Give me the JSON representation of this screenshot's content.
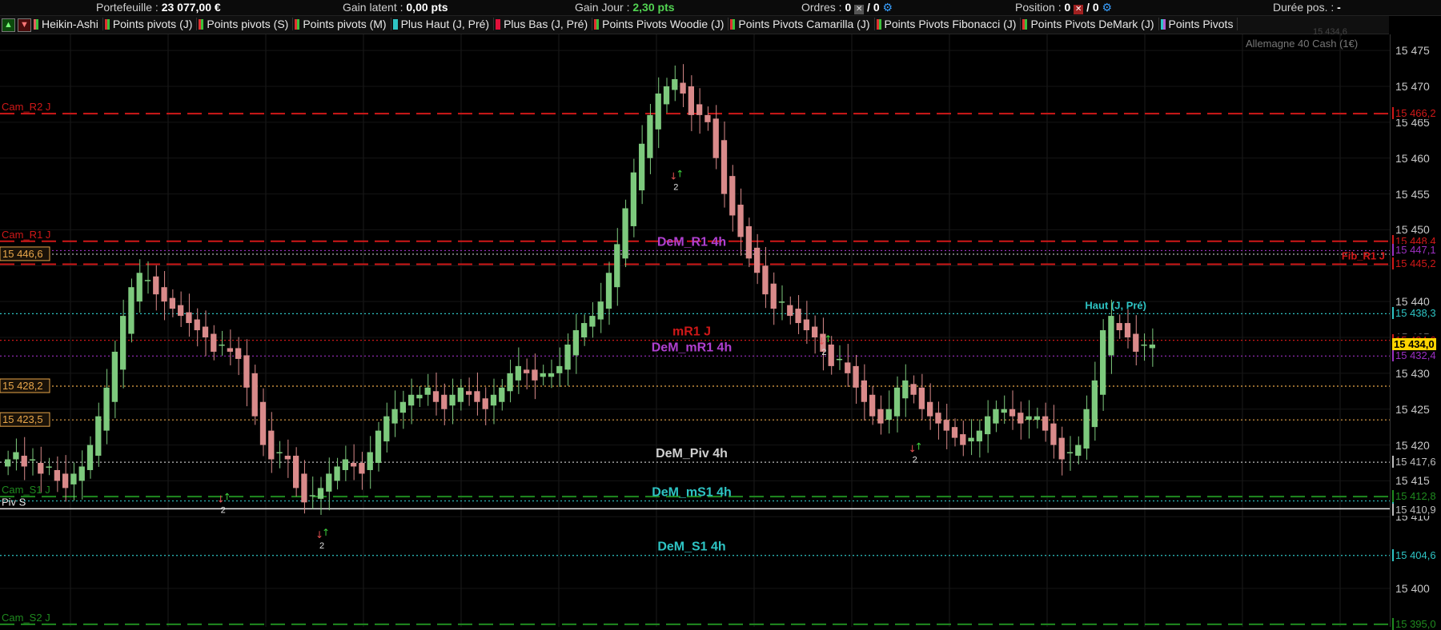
{
  "header": {
    "portefeuille_label": "Portefeuille :",
    "portefeuille_value": "23 077,00 €",
    "gain_latent_label": "Gain latent :",
    "gain_latent_value": "0,00 pts",
    "gain_jour_label": "Gain Jour :",
    "gain_jour_value": "2,30 pts",
    "ordres_label": "Ordres :",
    "ordres_value": "0",
    "ordres_value2": "/ 0",
    "position_label": "Position :",
    "position_value": "0",
    "position_value2": "/ 0",
    "duree_label": "Durée pos. :",
    "duree_value": "-"
  },
  "indicators": [
    {
      "label": "Heikin-Ashi",
      "c1": "#e06060",
      "c2": "#3bbf3b"
    },
    {
      "label": "Points pivots (J)",
      "c1": "#e03030",
      "c2": "#3bbf3b"
    },
    {
      "label": "Points pivots (S)",
      "c1": "#e03030",
      "c2": "#3bbf3b"
    },
    {
      "label": "Points pivots (M)",
      "c1": "#e03030",
      "c2": "#3bbf3b"
    },
    {
      "label": "Plus Haut (J, Pré)",
      "c1": "#2ec4c4",
      "c2": "#2ec4c4"
    },
    {
      "label": "Plus Bas (J, Pré)",
      "c1": "#e0103a",
      "c2": "#e0103a"
    },
    {
      "label": "Points Pivots Woodie (J)",
      "c1": "#e03030",
      "c2": "#3bbf3b"
    },
    {
      "label": "Points Pivots Camarilla (J)",
      "c1": "#e03030",
      "c2": "#3bbf3b"
    },
    {
      "label": "Points Pivots Fibonacci (J)",
      "c1": "#e03030",
      "c2": "#3bbf3b"
    },
    {
      "label": "Points Pivots DeMark (J)",
      "c1": "#e03030",
      "c2": "#3bbf3b"
    },
    {
      "label": "Points Pivots",
      "c1": "#2ec4c4",
      "c2": "#b05fd0"
    }
  ],
  "instrument": "Allemagne 40 Cash (1€)",
  "instrument_ghost": "15 434,6",
  "axis_ticks": [
    "15 475",
    "15 470",
    "15 465",
    "15 460",
    "15 455",
    "15 450",
    "15 445",
    "15 440",
    "15 435",
    "15 430",
    "15 425",
    "15 420",
    "15 415",
    "15 410",
    "15 400"
  ],
  "tick_values": [
    15475,
    15470,
    15465,
    15460,
    15455,
    15450,
    15445,
    15440,
    15435,
    15430,
    15425,
    15420,
    15415,
    15410,
    15400
  ],
  "levels": [
    {
      "value": 15466.2,
      "tag": "15 466,2",
      "tagColor": "#d01818",
      "color": "#d01818",
      "style": "dash",
      "left": "Cam_R2 J",
      "leftColor": "#d01818"
    },
    {
      "value": 15448.4,
      "tag": "15 448,4",
      "tagColor": "#d01818",
      "color": "#d01818",
      "style": "dash",
      "left": "Cam_R1 J",
      "leftColor": "#d01818"
    },
    {
      "value": 15447.1,
      "tag": "15 447,1",
      "tagColor": "#9b2fc0",
      "color": "#9b2fc0",
      "style": "dot",
      "center": "DeM_R1 4h",
      "centerColor": "#b040d0"
    },
    {
      "value": 15446.6,
      "tag": "",
      "color": "#c8c8c8",
      "style": "dot",
      "leftBox": "15 446,6",
      "leftBoxColor": "#e8a64a"
    },
    {
      "value": 15445.2,
      "tag": "15 445,2",
      "tagColor": "#d01818",
      "color": "#d01818",
      "style": "dash",
      "right": "Fib_R1 J",
      "rightColor": "#d01818"
    },
    {
      "value": 15438.3,
      "tag": "15 438,3",
      "tagColor": "#2ec4c4",
      "color": "#2ec4c4",
      "style": "dot",
      "right": "Haut (J, Pré)",
      "rightColor": "#2ec4c4"
    },
    {
      "value": 15434.6,
      "tag": "15 434,6",
      "tagColor": "#d01818",
      "color": "#d01818",
      "style": "dot",
      "center": "mR1 J",
      "centerColor": "#d01818"
    },
    {
      "value": 15432.4,
      "tag": "15 432,4",
      "tagColor": "#9b2fc0",
      "color": "#9b2fc0",
      "style": "dot",
      "center": "DeM_mR1 4h",
      "centerColor": "#b040d0"
    },
    {
      "value": 15428.2,
      "tag": "",
      "color": "#e8a64a",
      "style": "dot",
      "leftBox": "15 428,2",
      "leftBoxColor": "#e8a64a"
    },
    {
      "value": 15423.5,
      "tag": "",
      "color": "#e8a64a",
      "style": "dot",
      "leftBox": "15 423,5",
      "leftBoxColor": "#e8a64a"
    },
    {
      "value": 15417.6,
      "tag": "15 417,6",
      "tagColor": "#bdbdbd",
      "color": "#bdbdbd",
      "style": "dot",
      "center": "DeM_Piv 4h",
      "centerColor": "#cfcfcf"
    },
    {
      "value": 15412.8,
      "tag": "15 412,8",
      "tagColor": "#1f8a1f",
      "color": "#1f8a1f",
      "style": "dash",
      "left": "Cam_S1 J",
      "leftColor": "#1f8a1f"
    },
    {
      "value": 15412.2,
      "tag": "",
      "color": "#2ec4c4",
      "style": "dot",
      "center": "DeM_mS1 4h",
      "centerColor": "#2ec4c4"
    },
    {
      "value": 15411.1,
      "tag": "15 411,1",
      "tagColor": "#2ec4c4",
      "color": "#e8e8e8",
      "style": "solid",
      "left": "Piv S",
      "leftColor": "#e8e8e8"
    },
    {
      "value": 15410.9,
      "tag": "15 410,9",
      "tagColor": "#bdbdbd",
      "color": "#333333",
      "style": "none"
    },
    {
      "value": 15404.6,
      "tag": "15 404,6",
      "tagColor": "#2ec4c4",
      "color": "#2ec4c4",
      "style": "dot",
      "center": "DeM_S1 4h",
      "centerColor": "#2ec4c4"
    },
    {
      "value": 15395.0,
      "tag": "15 395,0",
      "tagColor": "#1f8a1f",
      "color": "#1f8a1f",
      "style": "dash",
      "left": "Cam_S2 J",
      "leftColor": "#1f8a1f"
    }
  ],
  "current_price": {
    "value": 15434.0,
    "tag": "15 434,0",
    "bg": "#ffd400"
  },
  "candles": [
    15418,
    15419,
    15417,
    15418,
    15416,
    15417,
    15415,
    15414,
    15416,
    15417,
    15420,
    15424,
    15428,
    15433,
    15438,
    15442,
    15444,
    15443,
    15441,
    15440,
    15439,
    15438,
    15437,
    15436,
    15435,
    15433,
    15434,
    15433,
    15432,
    15428,
    15424,
    15420,
    15418,
    15419,
    15418,
    15414,
    15412,
    15413,
    15414,
    15416,
    15417,
    15418,
    15417,
    15416,
    15419,
    15422,
    15424,
    15425,
    15426,
    15427,
    15427,
    15428,
    15426,
    15425,
    15427,
    15428,
    15427,
    15426,
    15425,
    15427,
    15428,
    15430,
    15431,
    15430,
    15429,
    15430,
    15430,
    15431,
    15434,
    15436,
    15437,
    15438,
    15440,
    15444,
    15448,
    15453,
    15458,
    15462,
    15466,
    15469,
    15470,
    15471,
    15469,
    15466,
    15466,
    15465,
    15460,
    15455,
    15452,
    15449,
    15446,
    15444,
    15441,
    15439,
    15440,
    15438,
    15437,
    15436,
    15435,
    15433,
    15431,
    15432,
    15430,
    15428,
    15426,
    15424,
    15423,
    15425,
    15428,
    15429,
    15427,
    15425,
    15424,
    15423,
    15422,
    15421,
    15420,
    15421,
    15422,
    15424,
    15425,
    15425,
    15424,
    15423,
    15424,
    15424,
    15422,
    15420,
    15418,
    15419,
    15420,
    15425,
    15429,
    15436,
    15438,
    15436,
    15435,
    15433,
    15434,
    15434
  ],
  "signals": [
    {
      "i": 26,
      "price": 15412,
      "label": "2"
    },
    {
      "i": 38,
      "price": 15407,
      "label": "2"
    },
    {
      "i": 81,
      "price": 15457,
      "label": "2"
    },
    {
      "i": 99,
      "price": 15434,
      "label": "2"
    },
    {
      "i": 110,
      "price": 15419,
      "label": "2"
    }
  ]
}
